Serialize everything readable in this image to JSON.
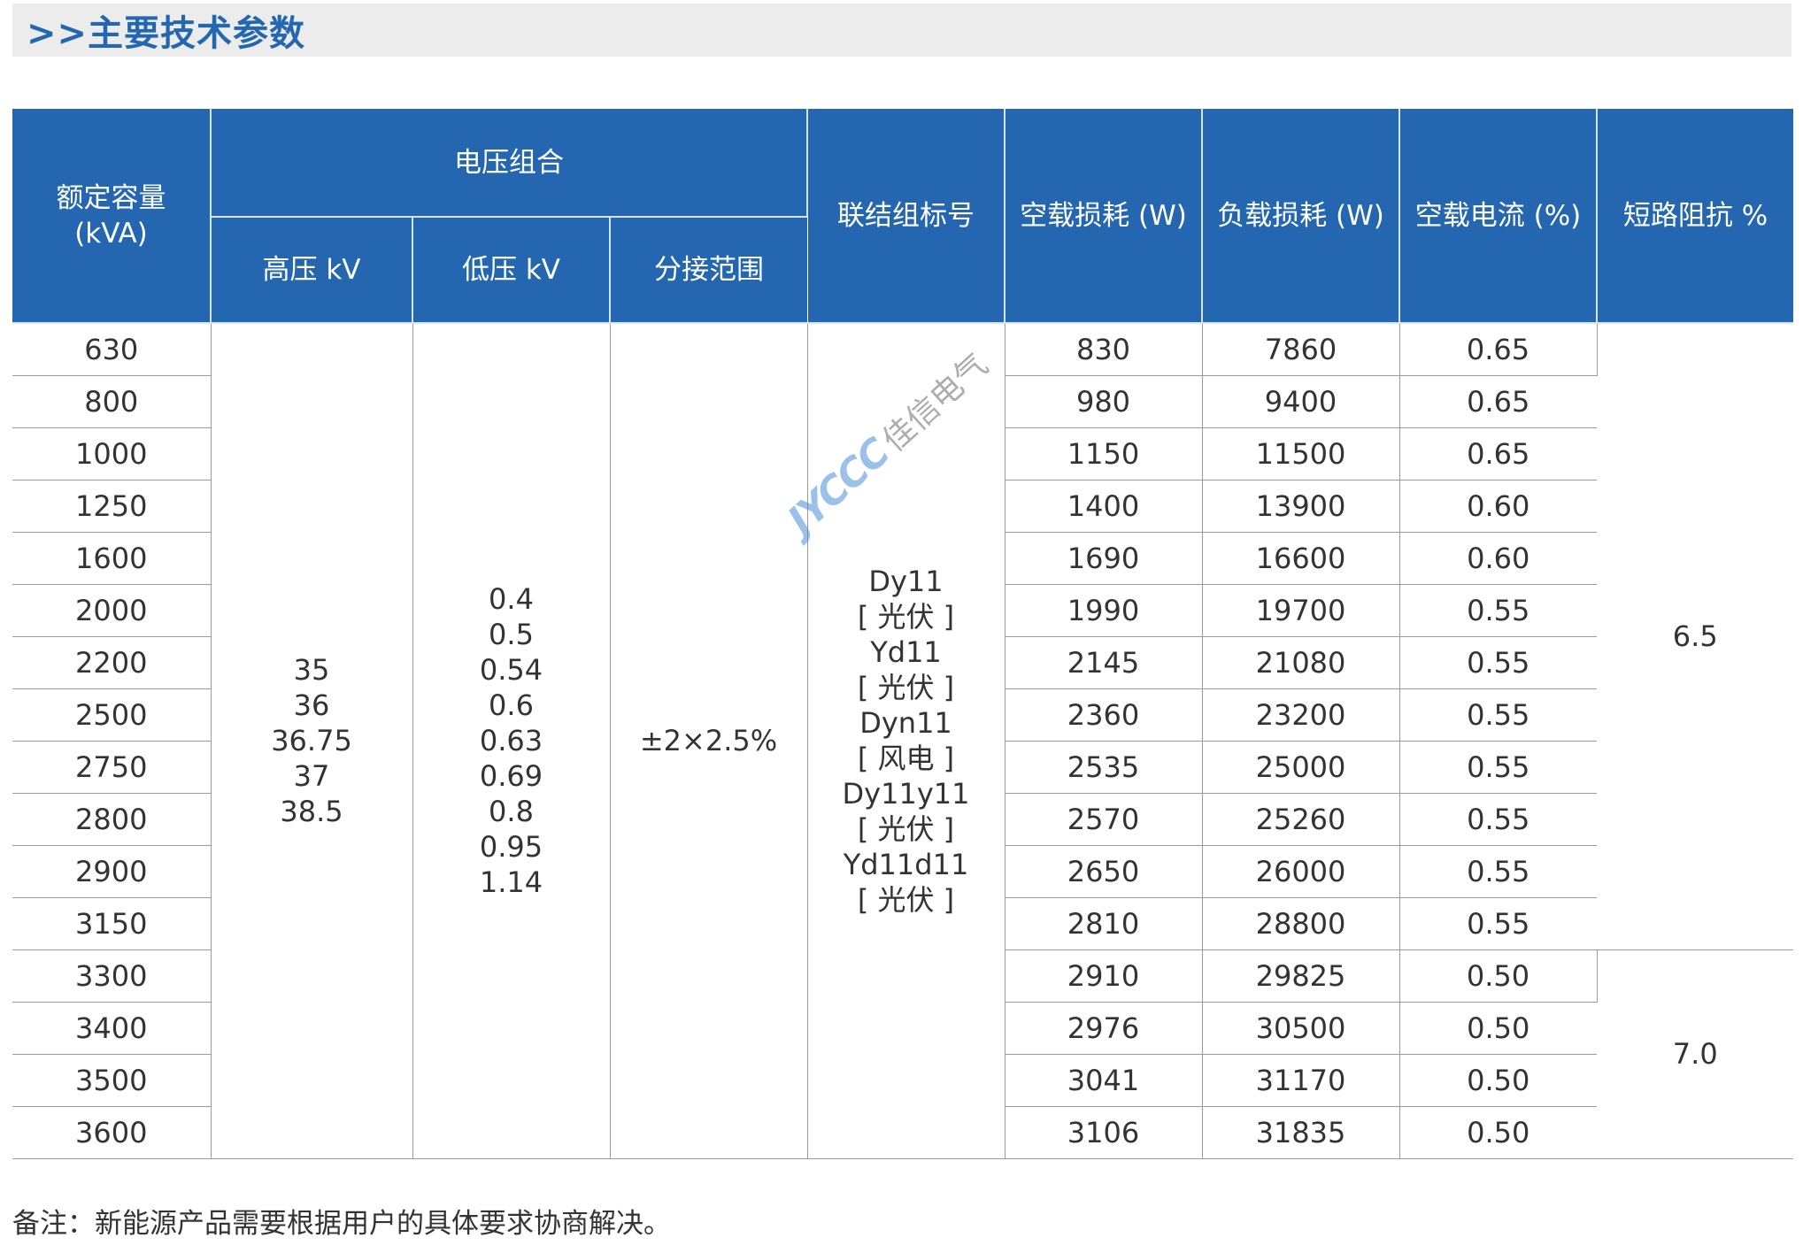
{
  "header": {
    "title": ">>主要技术参数"
  },
  "table": {
    "headers": {
      "capacity": "额定容量",
      "capacity_unit": "(kVA)",
      "voltage_group": "电压组合",
      "hv": "高压 kV",
      "lv": "低压 kV",
      "tap": "分接范围",
      "vector": "联结组标号",
      "no_load_loss": "空载损耗 (W)",
      "load_loss": "负载损耗 (W)",
      "no_load_current": "空载电流 (%)",
      "impedance": "短路阻抗 %"
    },
    "rows": [
      {
        "capacity": "630",
        "no_load_loss": "830",
        "load_loss": "7860",
        "no_load_current": "0.65"
      },
      {
        "capacity": "800",
        "no_load_loss": "980",
        "load_loss": "9400",
        "no_load_current": "0.65"
      },
      {
        "capacity": "1000",
        "no_load_loss": "1150",
        "load_loss": "11500",
        "no_load_current": "0.65"
      },
      {
        "capacity": "1250",
        "no_load_loss": "1400",
        "load_loss": "13900",
        "no_load_current": "0.60"
      },
      {
        "capacity": "1600",
        "no_load_loss": "1690",
        "load_loss": "16600",
        "no_load_current": "0.60"
      },
      {
        "capacity": "2000",
        "no_load_loss": "1990",
        "load_loss": "19700",
        "no_load_current": "0.55"
      },
      {
        "capacity": "2200",
        "no_load_loss": "2145",
        "load_loss": "21080",
        "no_load_current": "0.55"
      },
      {
        "capacity": "2500",
        "no_load_loss": "2360",
        "load_loss": "23200",
        "no_load_current": "0.55"
      },
      {
        "capacity": "2750",
        "no_load_loss": "2535",
        "load_loss": "25000",
        "no_load_current": "0.55"
      },
      {
        "capacity": "2800",
        "no_load_loss": "2570",
        "load_loss": "25260",
        "no_load_current": "0.55"
      },
      {
        "capacity": "2900",
        "no_load_loss": "2650",
        "load_loss": "26000",
        "no_load_current": "0.55"
      },
      {
        "capacity": "3150",
        "no_load_loss": "2810",
        "load_loss": "28800",
        "no_load_current": "0.55"
      },
      {
        "capacity": "3300",
        "no_load_loss": "2910",
        "load_loss": "29825",
        "no_load_current": "0.50"
      },
      {
        "capacity": "3400",
        "no_load_loss": "2976",
        "load_loss": "30500",
        "no_load_current": "0.50"
      },
      {
        "capacity": "3500",
        "no_load_loss": "3041",
        "load_loss": "31170",
        "no_load_current": "0.50"
      },
      {
        "capacity": "3600",
        "no_load_loss": "3106",
        "load_loss": "31835",
        "no_load_current": "0.50"
      }
    ],
    "hv_values": [
      "35",
      "36",
      "36.75",
      "37",
      "38.5"
    ],
    "lv_values": [
      "0.4",
      "0.5",
      "0.54",
      "0.6",
      "0.63",
      "0.69",
      "0.8",
      "0.95",
      "1.14"
    ],
    "tap_range": "±2×2.5%",
    "vector_groups": [
      "Dy11",
      "[ 光伏 ]",
      "Yd11",
      "[ 光伏 ]",
      "Dyn11",
      "[ 风电 ]",
      "Dy11y11",
      "[ 光伏 ]",
      "Yd11d11",
      "[ 光伏 ]"
    ],
    "impedance_groups": [
      {
        "value": "6.5",
        "rows": 12
      },
      {
        "value": "7.0",
        "rows": 4
      }
    ]
  },
  "watermark": {
    "logo": "JYCCC",
    "text": "佳信电气"
  },
  "note": "备注：新能源产品需要根据用户的具体要求协商解决。"
}
